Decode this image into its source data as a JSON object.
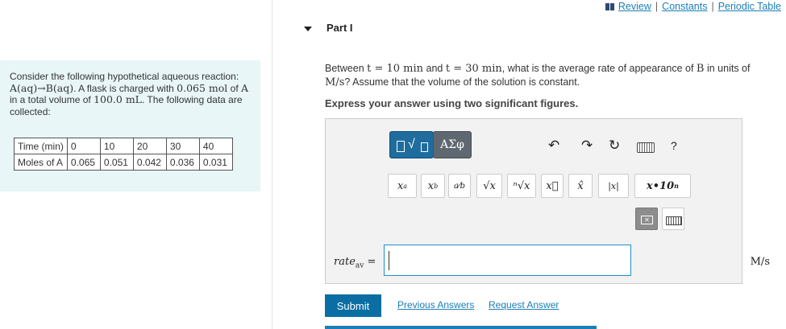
{
  "header": {
    "links": [
      "Review",
      "Constants",
      "Periodic Table"
    ],
    "separator": "|"
  },
  "problem": {
    "text_a": "Consider the following hypothetical aqueous reaction: ",
    "reaction": "A(aq)→B(aq)",
    "text_b": ". A flask is charged with ",
    "amount": "0.065 mol",
    "text_c": " of ",
    "species": "A",
    "text_d": " in a total volume of ",
    "volume": "100.0 mL",
    "text_e": ". The following data are collected:"
  },
  "data_table": {
    "row_labels": [
      "Time (min)",
      "Moles of A"
    ],
    "time": [
      "0",
      "10",
      "20",
      "30",
      "40"
    ],
    "moles": [
      "0.065",
      "0.051",
      "0.042",
      "0.036",
      "0.031"
    ]
  },
  "part": {
    "title": "Part I",
    "question_a": "Between ",
    "t1": "t = 10 min",
    "question_b": " and ",
    "t2": "t = 30 min",
    "question_c": ", what is the average rate of appearance of ",
    "species_b": "B",
    "question_d": " in units of ",
    "unit_q": "M/s",
    "question_e": "? Assume that the volume of the solution is constant.",
    "instruction": "Express your answer using two significant figures."
  },
  "toolbar": {
    "greek_label": "ΑΣφ",
    "help": "?",
    "keys": [
      "xa",
      "xb",
      "a/b",
      "√x",
      "n√x",
      "x⃗",
      "x̂",
      "|x|",
      "x•10n"
    ]
  },
  "answer": {
    "label": "rate",
    "label_sub": "av",
    "equals": "=",
    "value": "",
    "unit": "M/s"
  },
  "actions": {
    "submit": "Submit",
    "previous": "Previous Answers",
    "request": "Request Answer"
  },
  "colors": {
    "panel_bg": "#e8f6f8",
    "accent": "#0a6ea3",
    "link": "#1a7fb5",
    "greek_btn": "#5f6770"
  }
}
